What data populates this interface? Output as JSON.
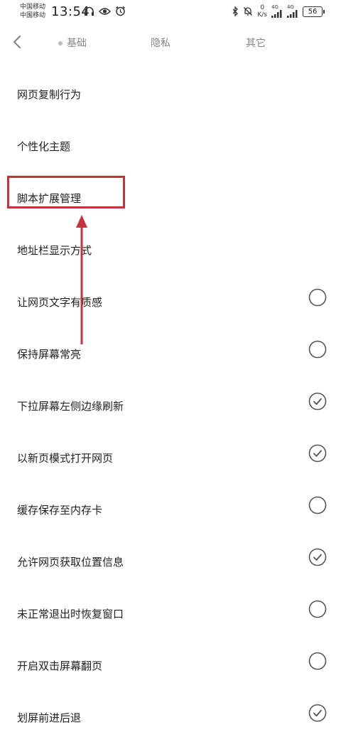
{
  "status_bar": {
    "carrier_1": "中国移动",
    "carrier_2": "中国移动",
    "time": "13:54",
    "net_speed_value": "0",
    "net_speed_unit": "K/s",
    "network_1": "4G",
    "network_2": "4G",
    "battery": "56",
    "icons": [
      "headphones-icon",
      "eye-icon",
      "alarm-icon",
      "bluetooth-icon",
      "mute-icon",
      "signal-icon",
      "battery-icon"
    ]
  },
  "tabs": [
    {
      "label": "基础",
      "active": true
    },
    {
      "label": "隐私",
      "active": false
    },
    {
      "label": "其它",
      "active": false
    }
  ],
  "settings": [
    {
      "label": "网页复制行为",
      "toggle": null
    },
    {
      "label": "个性化主题",
      "toggle": null
    },
    {
      "label": "脚本扩展管理",
      "toggle": null
    },
    {
      "label": "地址栏显示方式",
      "toggle": null
    },
    {
      "label": "让网页文字有质感",
      "toggle": false
    },
    {
      "label": "保持屏幕常亮",
      "toggle": false
    },
    {
      "label": "下拉屏幕左侧边缘刷新",
      "toggle": true
    },
    {
      "label": "以新页模式打开网页",
      "toggle": true
    },
    {
      "label": "缓存保存至内存卡",
      "toggle": false
    },
    {
      "label": "允许网页获取位置信息",
      "toggle": true
    },
    {
      "label": "未正常退出时恢复窗口",
      "toggle": false
    },
    {
      "label": "开启双击屏幕翻页",
      "toggle": false
    },
    {
      "label": "划屏前进后退",
      "toggle": true
    }
  ],
  "colors": {
    "annotation": "#c8323a",
    "check_stroke": "#555555",
    "text": "#222222",
    "tab_inactive": "#888888"
  }
}
